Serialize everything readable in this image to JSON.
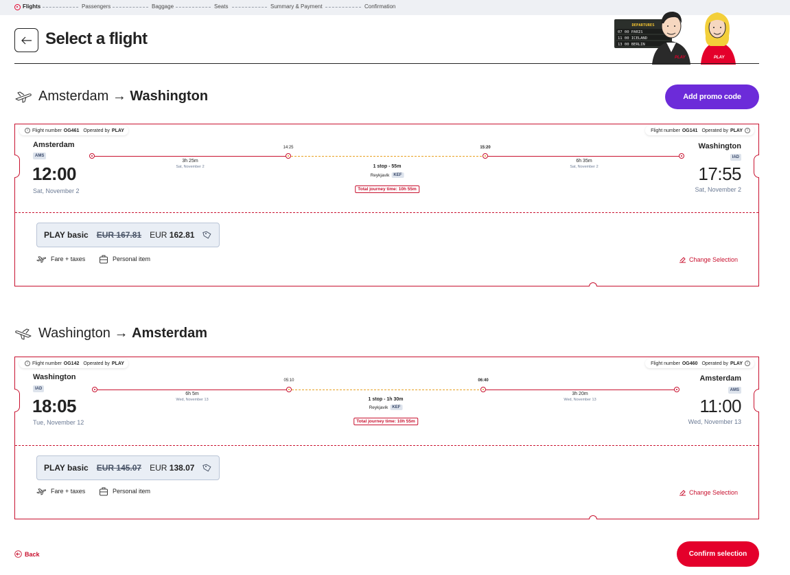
{
  "steps": [
    "Flights",
    "Passengers",
    "Baggage",
    "Seats",
    "Summary & Payment",
    "Confirmation"
  ],
  "header": {
    "title": "Select a flight",
    "board_title": "DEPARTURES",
    "board_rows": [
      "07 00 PARIS",
      "11 00 ICELAND",
      "13 00 BERLIN"
    ],
    "brand": "PLAY"
  },
  "promo_label": "Add promo code",
  "labels": {
    "flight_number": "Flight number",
    "operated_by": "Operated by",
    "total_journey": "Total journey time:",
    "fare_taxes": "Fare + taxes",
    "personal_item": "Personal item",
    "change_selection": "Change Selection",
    "arrow": "→"
  },
  "outbound": {
    "from": "Amsterdam",
    "to": "Washington",
    "flight1": "OG461",
    "flight2": "OG141",
    "operator": "PLAY",
    "dep_city": "Amsterdam",
    "dep_code": "AMS",
    "dep_time": "12:00",
    "dep_date": "Sat, November 2",
    "arr_city": "Washington",
    "arr_code": "IAD",
    "arr_time": "17:55",
    "arr_date": "Sat, November 2",
    "stop_arr": "14:25",
    "stop_dep": "15:20",
    "leg1_dur": "3h 25m",
    "leg1_date": "Sat, November 2",
    "leg2_dur": "6h 35m",
    "leg2_date": "Sat, November 2",
    "stop_info": "1 stop - 55m",
    "stop_city": "Reykjavik",
    "stop_code": "KEF",
    "journey_time": "10h 55m",
    "fare_name": "PLAY basic",
    "fare_old": "EUR 167.81",
    "fare_currency": "EUR",
    "fare_new": "162.81"
  },
  "inbound": {
    "from": "Washington",
    "to": "Amsterdam",
    "flight1": "OG142",
    "flight2": "OG460",
    "operator": "PLAY",
    "dep_city": "Washington",
    "dep_code": "IAD",
    "dep_time": "18:05",
    "dep_date": "Tue, November 12",
    "arr_city": "Amsterdam",
    "arr_code": "AMS",
    "arr_time": "11:00",
    "arr_date": "Wed, November 13",
    "stop_arr": "05:10",
    "stop_dep": "06:40",
    "leg1_dur": "6h 5m",
    "leg1_date": "Wed, November 13",
    "leg2_dur": "3h 20m",
    "leg2_date": "Wed, November 13",
    "stop_info": "1 stop - 1h 30m",
    "stop_city": "Reykjavik",
    "stop_code": "KEF",
    "journey_time": "10h 55m",
    "fare_name": "PLAY basic",
    "fare_old": "EUR 145.07",
    "fare_currency": "EUR",
    "fare_new": "138.07"
  },
  "footer": {
    "back_label": "Back",
    "confirm_label": "Confirm selection"
  },
  "colors": {
    "brand_red": "#e4002b",
    "promo_purple": "#6c2bd9"
  }
}
